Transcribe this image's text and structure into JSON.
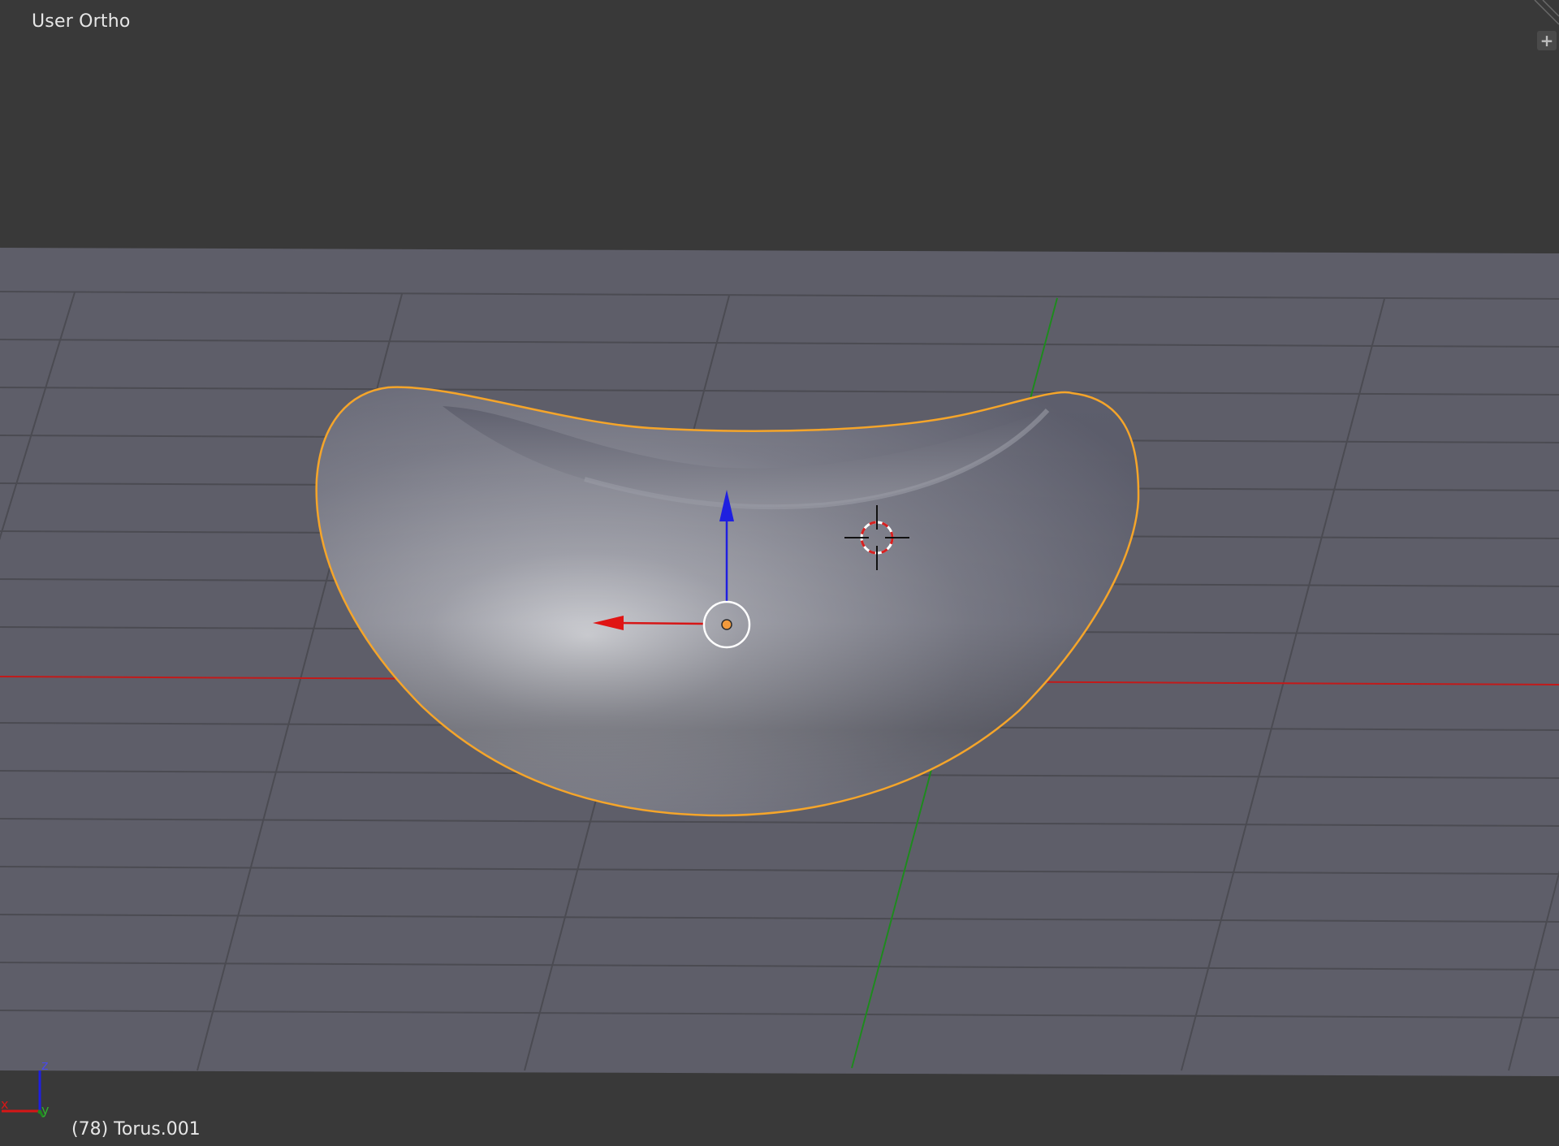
{
  "viewport": {
    "view_name": "User Ortho",
    "active_object": "(78) Torus.001"
  },
  "controls": {
    "toolshelf_toggle": "+"
  },
  "axis_widget": {
    "x": "x",
    "y": "y",
    "z": "z"
  },
  "icons": {
    "toolshelf_toggle": "plus-icon",
    "cursor": "3d-cursor-icon",
    "origin": "object-origin-icon",
    "manipulator": "transform-manipulator-icon"
  },
  "colors": {
    "background": "#393939",
    "grid_plane": "#5e5e69",
    "grid_line": "#4b4b52",
    "x_axis": "#c21a1a",
    "y_axis": "#1e8a1e",
    "z_axis": "#1f1fe0",
    "selection_outline": "#f5a52a",
    "origin_dot": "#f29a3c"
  }
}
